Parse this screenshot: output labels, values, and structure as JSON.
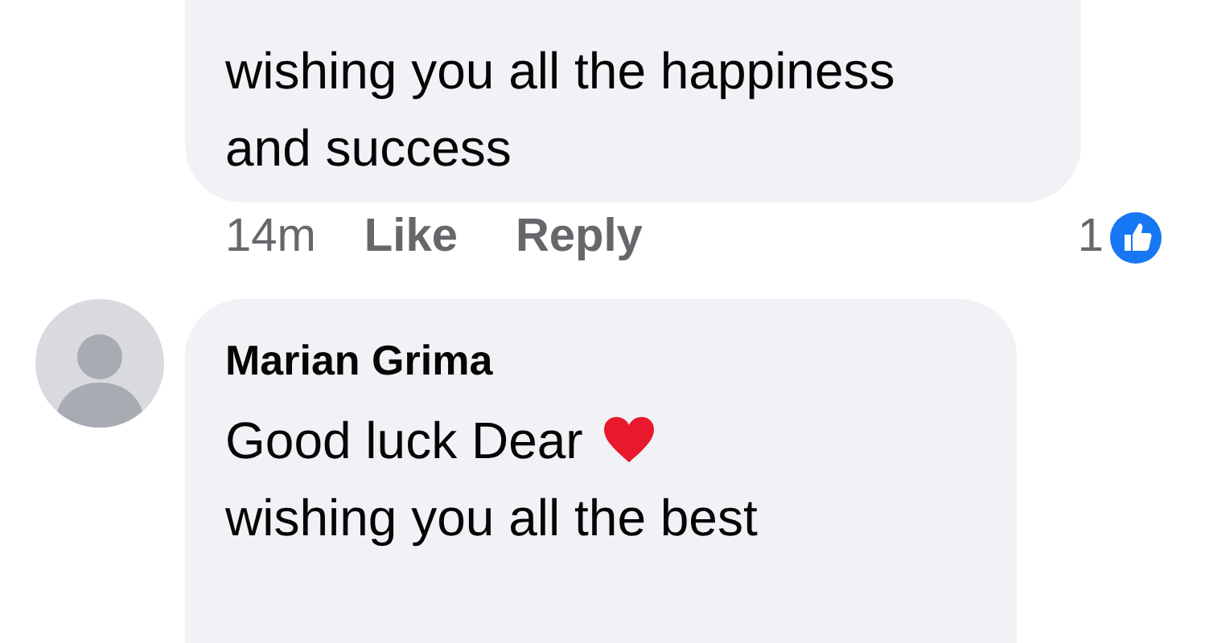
{
  "comments": [
    {
      "lines": [
        {
          "text": "wishing you all the happiness"
        },
        {
          "text": "and success"
        }
      ],
      "time": "14m",
      "actions": [
        "Like",
        "Reply"
      ],
      "reaction_count": "1"
    },
    {
      "author": "Marian Grima",
      "lines": [
        {
          "text": "Good luck Dear",
          "heart": true
        },
        {
          "text": "wishing you all the best"
        }
      ]
    }
  ]
}
